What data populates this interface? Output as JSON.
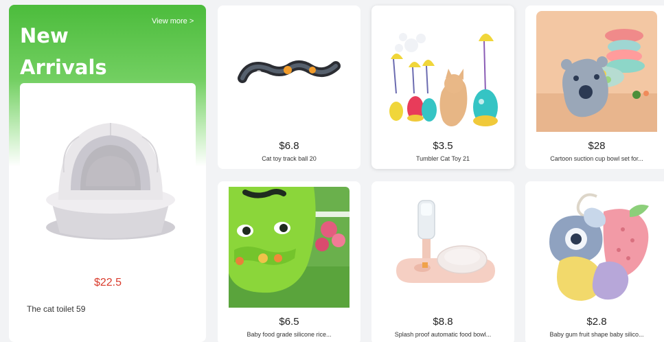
{
  "featured": {
    "title": "New\nArrivals",
    "view_more": "View more >",
    "product": {
      "price": "$22.5",
      "name": "The cat toilet 59",
      "image": "cat-litter-dome-image"
    }
  },
  "products": [
    {
      "price": "$6.8",
      "name": "Cat toy track ball 20",
      "image": "cat-track-ball-toy-image"
    },
    {
      "price": "$3.5",
      "name": "Tumbler Cat Toy 21",
      "image": "tumbler-cat-toy-image"
    },
    {
      "price": "$28",
      "name": "Cartoon suction cup bowl set for...",
      "image": "suction-bowl-set-image"
    },
    {
      "price": "$6.5",
      "name": "Baby food grade silicone rice...",
      "image": "silicone-bib-image"
    },
    {
      "price": "$8.8",
      "name": "Splash proof automatic food bowl...",
      "image": "automatic-food-bowl-image"
    },
    {
      "price": "$2.8",
      "name": "Baby gum fruit shape baby silico...",
      "image": "teether-toy-image"
    }
  ],
  "colors": {
    "featured_green": "#4cbc3c",
    "price_red": "#d93a2b",
    "page_bg": "#f2f3f5"
  }
}
